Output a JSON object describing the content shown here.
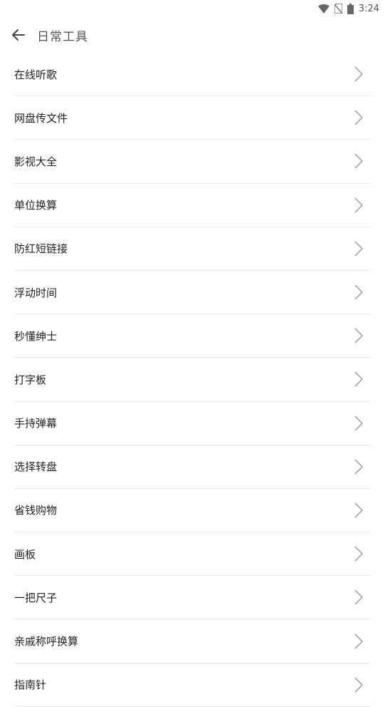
{
  "status_bar": {
    "time": "3:24"
  },
  "toolbar": {
    "title": "日常工具"
  },
  "items": [
    {
      "label": "在线听歌"
    },
    {
      "label": "网盘传文件"
    },
    {
      "label": "影视大全"
    },
    {
      "label": "单位换算"
    },
    {
      "label": "防红短链接"
    },
    {
      "label": "浮动时间"
    },
    {
      "label": "秒懂绅士"
    },
    {
      "label": "打字板"
    },
    {
      "label": "手持弹幕"
    },
    {
      "label": "选择转盘"
    },
    {
      "label": "省钱购物"
    },
    {
      "label": "画板"
    },
    {
      "label": "一把尺子"
    },
    {
      "label": "亲戚称呼换算"
    },
    {
      "label": "指南针"
    }
  ]
}
